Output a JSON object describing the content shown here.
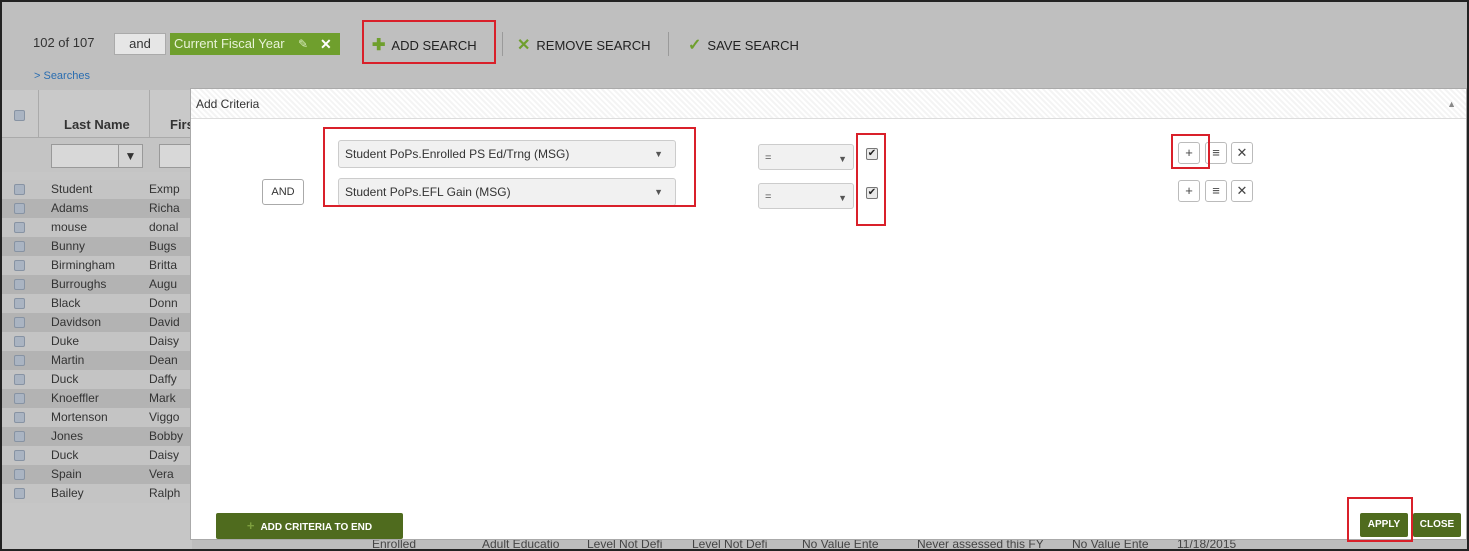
{
  "topbar": {
    "count": "102 of 107",
    "and_label": "and",
    "filter_chip": "Current Fiscal Year",
    "add_search": "ADD SEARCH",
    "remove_search": "REMOVE SEARCH",
    "save_search": "SAVE SEARCH",
    "searches_link": "> Searches"
  },
  "table": {
    "columns": [
      "Last Name",
      "First"
    ],
    "rows": [
      {
        "last": "Student",
        "first": "Exmp"
      },
      {
        "last": "Adams",
        "first": "Richa"
      },
      {
        "last": "mouse",
        "first": "donal"
      },
      {
        "last": "Bunny",
        "first": "Bugs"
      },
      {
        "last": "Birmingham",
        "first": "Britta"
      },
      {
        "last": "Burroughs",
        "first": "Augu"
      },
      {
        "last": "Black",
        "first": "Donn"
      },
      {
        "last": "Davidson",
        "first": "David"
      },
      {
        "last": "Duke",
        "first": "Daisy"
      },
      {
        "last": "Martin",
        "first": "Dean"
      },
      {
        "last": "Duck",
        "first": "Daffy"
      },
      {
        "last": "Knoeffler",
        "first": "Mark"
      },
      {
        "last": "Mortenson",
        "first": "Viggo"
      },
      {
        "last": "Jones",
        "first": "Bobby"
      },
      {
        "last": "Duck",
        "first": "Daisy"
      },
      {
        "last": "Spain",
        "first": "Vera"
      },
      {
        "last": "Bailey",
        "first": "Ralph"
      }
    ],
    "bottom_strip": [
      "Enrolled",
      "Adult Educatio",
      "Level Not Defi",
      "Level Not Defi",
      "No Value Ente",
      "Never assessed this FY",
      "No Value Ente",
      "11/18/2015"
    ]
  },
  "modal": {
    "title": "Add Criteria",
    "connector": "AND",
    "criteria": [
      {
        "field": "Student PoPs.Enrolled PS Ed/Trng (MSG)",
        "operator": "=",
        "checked": true
      },
      {
        "field": "Student PoPs.EFL Gain (MSG)",
        "operator": "=",
        "checked": true
      }
    ],
    "add_criteria_end": "ADD CRITERIA TO END",
    "apply": "APPLY",
    "close": "CLOSE"
  },
  "colors": {
    "accent_green": "#4f6b1e",
    "chip_green": "#6f9f2d",
    "highlight_red": "#d9202a"
  },
  "icons": [
    "plus-icon",
    "remove-x-icon",
    "check-icon",
    "pencil-icon",
    "filter-icon",
    "insert-icon",
    "close-icon",
    "caret-up-icon",
    "chevron-down-icon"
  ]
}
